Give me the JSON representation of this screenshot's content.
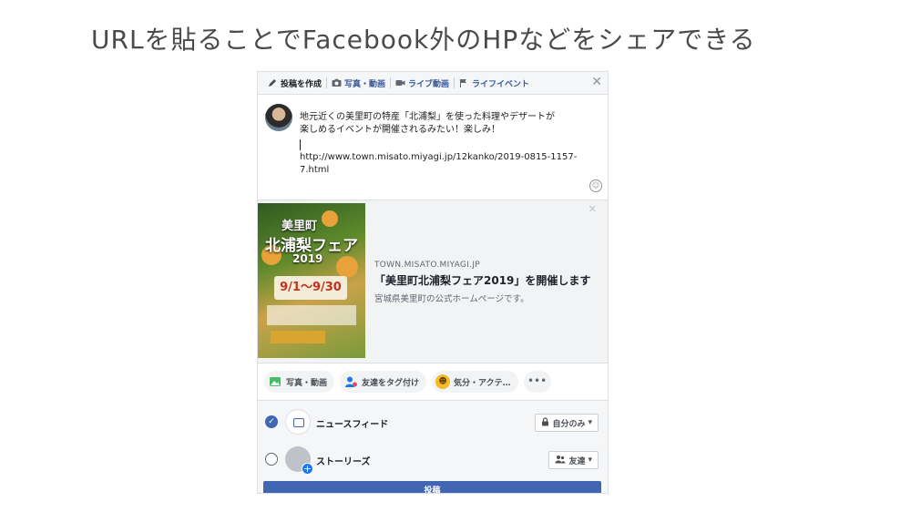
{
  "slide": {
    "title": "URLを貼ることでFacebook外のHPなどをシェアできる"
  },
  "composer": {
    "tabs": [
      {
        "label": "投稿を作成",
        "icon": "pencil-icon"
      },
      {
        "label": "写真・動画",
        "icon": "camera-icon"
      },
      {
        "label": "ライブ動画",
        "icon": "video-camera-icon"
      },
      {
        "label": "ライフイベント",
        "icon": "flag-icon"
      }
    ],
    "post_lines": [
      "地元近くの美里町の特産「北浦梨」を使った料理やデザートが",
      "楽しめるイベントが開催されるみたい！楽しみ！",
      "http://www.town.misato.miyagi.jp/12kanko/2019-0815-1157-",
      "7.html"
    ],
    "preview": {
      "poster_line1": "美里町",
      "poster_line2": "北浦梨フェア",
      "poster_year": "2019",
      "poster_date": "9/1〜9/30",
      "domain": "TOWN.MISATO.MIYAGI.JP",
      "title": "「美里町北浦梨フェア2019」を開催します",
      "description": "宮城県美里町の公式ホームページです。"
    },
    "chips": [
      {
        "label": "写真・動画",
        "icon": "photo-icon",
        "color": "#45bd62"
      },
      {
        "label": "友達をタグ付け",
        "icon": "tag-friend-icon",
        "color": "#1877f2"
      },
      {
        "label": "気分・アクテ…",
        "icon": "smiley-icon",
        "color": "#f7b928"
      }
    ],
    "destinations": {
      "newsfeed": {
        "label": "ニュースフィード",
        "privacy": "自分のみ",
        "checked": true
      },
      "stories": {
        "label": "ストーリーズ",
        "privacy": "友達",
        "checked": false
      }
    },
    "post_button": "投稿"
  },
  "colors": {
    "accent": "#4267b2",
    "link": "#385898"
  }
}
